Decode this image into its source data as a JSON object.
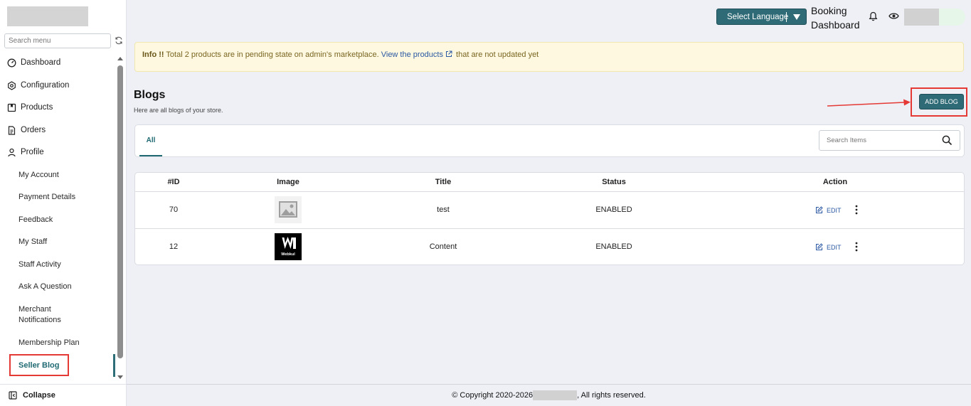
{
  "sidebar": {
    "search_placeholder": "Search menu",
    "items": [
      {
        "label": "Dashboard"
      },
      {
        "label": "Configuration"
      },
      {
        "label": "Products"
      },
      {
        "label": "Orders"
      },
      {
        "label": "Profile"
      }
    ],
    "sub_items": [
      {
        "label": "My Account"
      },
      {
        "label": "Payment Details"
      },
      {
        "label": "Feedback"
      },
      {
        "label": "My Staff"
      },
      {
        "label": "Staff Activity"
      },
      {
        "label": "Ask A Question"
      },
      {
        "label": "Merchant Notifications"
      },
      {
        "label": "Membership Plan"
      },
      {
        "label": "Seller Blog"
      }
    ],
    "collapse_label": "Collapse"
  },
  "header": {
    "language_button": "Select Language",
    "booking_line1": "Booking",
    "booking_line2": "Dashboard"
  },
  "info": {
    "prefix": "Info !!",
    "text_before_link": " Total 2 products are in pending state on admin's marketplace. ",
    "link_text": "View the products",
    "text_after_link": " that are not updated yet"
  },
  "page": {
    "title": "Blogs",
    "subtitle": "Here are all blogs of your store.",
    "add_button": "ADD BLOG"
  },
  "tabs": {
    "all": "All",
    "search_placeholder": "Search Items"
  },
  "table": {
    "headers": {
      "id": "#ID",
      "image": "Image",
      "title": "Title",
      "status": "Status",
      "action": "Action"
    },
    "rows": [
      {
        "id": "70",
        "title": "test",
        "status": "ENABLED",
        "edit": "EDIT",
        "image": "placeholder-image"
      },
      {
        "id": "12",
        "title": "Content",
        "status": "ENABLED",
        "edit": "EDIT",
        "image": "webkul-logo"
      }
    ]
  },
  "footer": {
    "before": "© Copyright 2020-2026 ",
    "after": ", All rights reserved."
  },
  "colors": {
    "accent": "#2f6b76",
    "highlight": "#e53935",
    "info_bg": "#fdf8df",
    "link": "#2b58a3"
  }
}
